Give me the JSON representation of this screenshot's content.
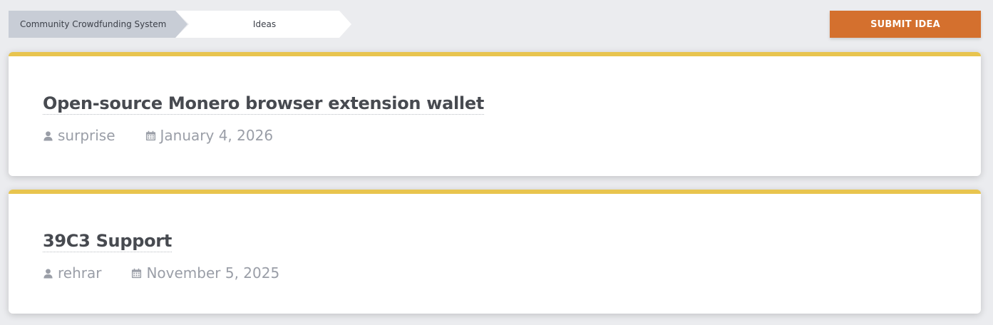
{
  "breadcrumb": {
    "root": "Community Crowdfunding System",
    "current": "Ideas"
  },
  "actions": {
    "submit_label": "SUBMIT IDEA"
  },
  "ideas": [
    {
      "title": "Open-source Monero browser extension wallet",
      "author": "surprise",
      "date": "January 4, 2026"
    },
    {
      "title": "39C3 Support",
      "author": "rehrar",
      "date": "November 5, 2025"
    }
  ],
  "icons": {
    "author": "user-icon",
    "date": "calendar-icon"
  },
  "colors": {
    "accent": "#e8c44e",
    "button": "#d4702e",
    "breadcrumb_root_bg": "#c8cdd6",
    "page_bg": "#ebecef",
    "meta_text": "#9a9ea7",
    "title_text": "#474a50"
  }
}
